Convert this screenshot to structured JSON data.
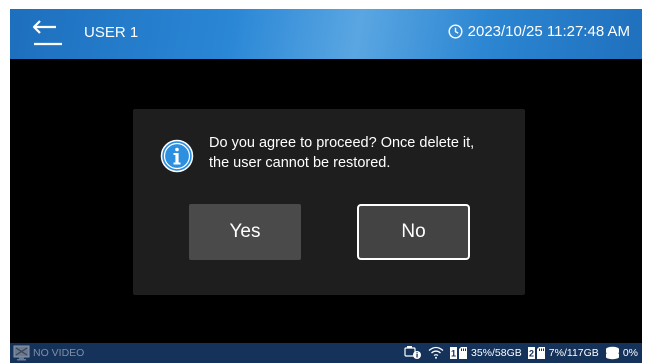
{
  "header": {
    "user_label": "USER 1",
    "datetime": "2023/10/25 11:27:48 AM",
    "icons": {
      "back": "back-arrow-icon",
      "clock": "clock-icon"
    }
  },
  "dialog": {
    "icon": "info-icon",
    "message_line1": "Do you agree to proceed? Once delete it,",
    "message_line2": "the user cannot be restored.",
    "yes_label": "Yes",
    "no_label": "No"
  },
  "statusbar": {
    "video_status": "NO VIDEO",
    "storage1_index": "1",
    "storage1": "35%/58GB",
    "storage2_index": "2",
    "storage2": "7%/117GB",
    "hdd": "0%",
    "icons": [
      "camera-info-icon",
      "wifi-icon",
      "sd-card-icon",
      "sd-card-icon",
      "hdd-icon"
    ]
  },
  "colors": {
    "header_blue": "#2a87d6",
    "statusbar_navy": "#14325a",
    "dialog_bg": "#1e1e1e",
    "button_bg": "#4a4a4a",
    "info_blue": "#2d8fe0"
  }
}
